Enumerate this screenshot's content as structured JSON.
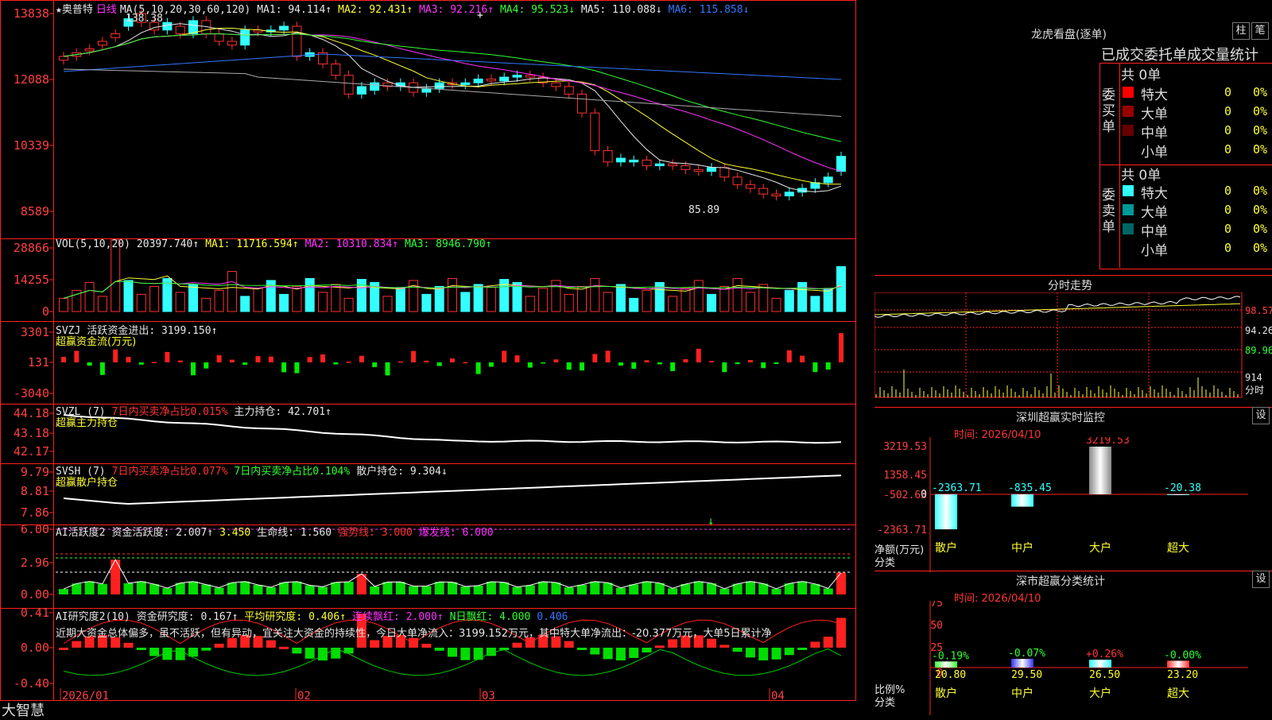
{
  "stock": {
    "name": "★奥普特",
    "period": "日线"
  },
  "price_pane": {
    "ma_legend": [
      {
        "text": "MA(5,10,20,30,60,120)",
        "color": "#e6e6e6"
      },
      {
        "text": "MA1: 94.114↑",
        "color": "#e6e6e6"
      },
      {
        "text": "MA2: 92.431↑",
        "color": "#ffff33"
      },
      {
        "text": "MA3: 92.216↑",
        "color": "#ff33ff"
      },
      {
        "text": "MA4: 95.523↓",
        "color": "#33ff33"
      },
      {
        "text": "MA5: 110.088↓",
        "color": "#e6e6e6"
      },
      {
        "text": "MA6: 115.858↓",
        "color": "#3377ff"
      }
    ],
    "y_ticks": [
      "13838",
      "12088",
      "10339",
      "8589"
    ],
    "high_label": "138.38",
    "low_label": "85.89"
  },
  "vol_pane": {
    "legend": [
      {
        "text": "VOL(5,10,20)",
        "color": "#e6e6e6"
      },
      {
        "text": "20397.740↑",
        "color": "#e6e6e6"
      },
      {
        "text": "MA1: 11716.594↑",
        "color": "#ffff33"
      },
      {
        "text": "MA2: 10310.834↑",
        "color": "#ff33ff"
      },
      {
        "text": "MA3: 8946.790↑",
        "color": "#33ff33"
      }
    ],
    "y_ticks": [
      "28866",
      "14255",
      "0"
    ]
  },
  "svzj_pane": {
    "legend": [
      {
        "text": "SVZJ",
        "color": "#e6e6e6"
      },
      {
        "text": "活跃资金进出: 3199.150↑",
        "color": "#e6e6e6"
      }
    ],
    "sub_label": "超赢资金流(万元)",
    "y_ticks": [
      "3301",
      "131",
      "-3040"
    ]
  },
  "svzl_pane": {
    "legend": [
      {
        "text": "SVZL (7)",
        "color": "#e6e6e6"
      },
      {
        "text": "7日内买卖净占比0.015%",
        "color": "#ff3333"
      },
      {
        "text": "主力持仓: 42.701↑",
        "color": "#e6e6e6"
      }
    ],
    "sub_label": "超赢主力持仓",
    "y_ticks": [
      "44.18",
      "43.18",
      "42.17"
    ]
  },
  "svsh_pane": {
    "legend": [
      {
        "text": "SVSH (7)",
        "color": "#e6e6e6"
      },
      {
        "text": "7日内买卖净占比0.077%",
        "color": "#ff3333"
      },
      {
        "text": "7日内买卖净占比0.104%",
        "color": "#33ff33"
      },
      {
        "text": "散户持仓: 9.304↓",
        "color": "#e6e6e6"
      }
    ],
    "sub_label": "超赢散户持仓",
    "y_ticks": [
      "9.79",
      "8.81",
      "7.86"
    ]
  },
  "ai_active_pane": {
    "legend": [
      {
        "text": "AI活跃度2",
        "color": "#e6e6e6"
      },
      {
        "text": "资金活跃度: 2.007↑",
        "color": "#e6e6e6"
      },
      {
        "text": "3.450",
        "color": "#ffff33"
      },
      {
        "text": "生命线: 1.560",
        "color": "#e6e6e6"
      },
      {
        "text": "强势线: 3.000",
        "color": "#ff3333"
      },
      {
        "text": "爆发线: 6.000",
        "color": "#ff33ff"
      }
    ],
    "y_ticks": [
      "6.00",
      "2.96",
      "0.00"
    ]
  },
  "ai_research_pane": {
    "legend": [
      {
        "text": "AI研究度2(10)",
        "color": "#e6e6e6"
      },
      {
        "text": "资金研究度: 0.167↑",
        "color": "#e6e6e6"
      },
      {
        "text": "平均研究度: 0.406↑",
        "color": "#ffff33"
      },
      {
        "text": "连续飘红: 2.000↑",
        "color": "#ff33ff"
      },
      {
        "text": "N日飘红: 4.000",
        "color": "#33ff33"
      },
      {
        "text": "0.406",
        "color": "#3377ff"
      }
    ],
    "comment": "近期大资金总体偏多，虽不活跃，但有异动，宜关注大资金的持续性，今日大单净流入：3199.152万元，其中特大单净流出：-20.377万元，大单5日累计净",
    "y_ticks": [
      "0.41",
      "0.00",
      "-0.40"
    ]
  },
  "x_axis": {
    "labels": [
      "2026/01",
      "02",
      "03",
      "04"
    ]
  },
  "brand": "大智慧",
  "longhu": {
    "title": "龙虎看盘(逐单)",
    "btn_zhu": "柱",
    "btn_bi": "笔",
    "subtitle": "已成交委托单成交量统计",
    "buy_label": "委买单",
    "sell_label": "委卖单",
    "buy_total": "共 0单",
    "sell_total": "共 0单",
    "buy_rows": [
      {
        "label": "特大",
        "count": "0",
        "pct": "0%",
        "color": "#ff0000"
      },
      {
        "label": "大单",
        "count": "0",
        "pct": "0%",
        "color": "#990000"
      },
      {
        "label": "中单",
        "count": "0",
        "pct": "0%",
        "color": "#660000"
      },
      {
        "label": "小单",
        "count": "0",
        "pct": "0%",
        "color": ""
      }
    ],
    "sell_rows": [
      {
        "label": "特大",
        "count": "0",
        "pct": "0%",
        "color": "#33ffff"
      },
      {
        "label": "大单",
        "count": "0",
        "pct": "0%",
        "color": "#009999"
      },
      {
        "label": "中单",
        "count": "0",
        "pct": "0%",
        "color": "#006666"
      },
      {
        "label": "小单",
        "count": "0",
        "pct": "0%",
        "color": ""
      }
    ]
  },
  "intraday": {
    "title": "分时走势",
    "y_ticks": [
      "98.57",
      "94.26",
      "89.96"
    ],
    "vol_tick": "914",
    "vol_label": "分时"
  },
  "sz_monitor": {
    "title": "深圳超赢实时监控",
    "settings": "设",
    "date": "时间: 2026/04/10",
    "y_ticks": [
      "3219.53",
      "1358.45",
      "-502.63",
      "-2363.71"
    ],
    "zero_tick": "0",
    "unit_label": "净额(万元)",
    "cat_label": "分类",
    "chart_data": {
      "type": "bar",
      "categories": [
        "散户",
        "中户",
        "大户",
        "超大"
      ],
      "values": [
        -2363.71,
        -835.45,
        3219.53,
        -20.38
      ],
      "value_labels": [
        "-2363.71",
        "-835.45",
        "3219.53",
        "-20.38"
      ],
      "ylim": [
        -2363.71,
        3219.53
      ],
      "colors": [
        "#33ffff",
        "#33ffff",
        "#ffffff",
        "#33ffff"
      ]
    }
  },
  "sz_class": {
    "title": "深市超赢分类统计",
    "settings": "设",
    "date": "时间: 2026/04/10",
    "y_ticks": [
      "75",
      "50",
      "25",
      "0"
    ],
    "unit_label": "比例%",
    "cat_label": "分类",
    "chart_data": {
      "type": "bar",
      "categories": [
        "散户",
        "中户",
        "大户",
        "超大"
      ],
      "values": [
        20.8,
        29.5,
        26.5,
        23.2
      ],
      "value_labels": [
        "20.80",
        "29.50",
        "26.50",
        "23.20"
      ],
      "changes": [
        "-0.19%",
        "-0.07%",
        "+0.26%",
        "-0.00%"
      ],
      "change_colors": [
        "#33ff33",
        "#33ff33",
        "#ff3333",
        "#33ff33"
      ],
      "ylim": [
        0,
        75
      ],
      "colors": [
        "#33ff33",
        "#3333ff",
        "#33ffff",
        "#ff3333"
      ]
    }
  }
}
